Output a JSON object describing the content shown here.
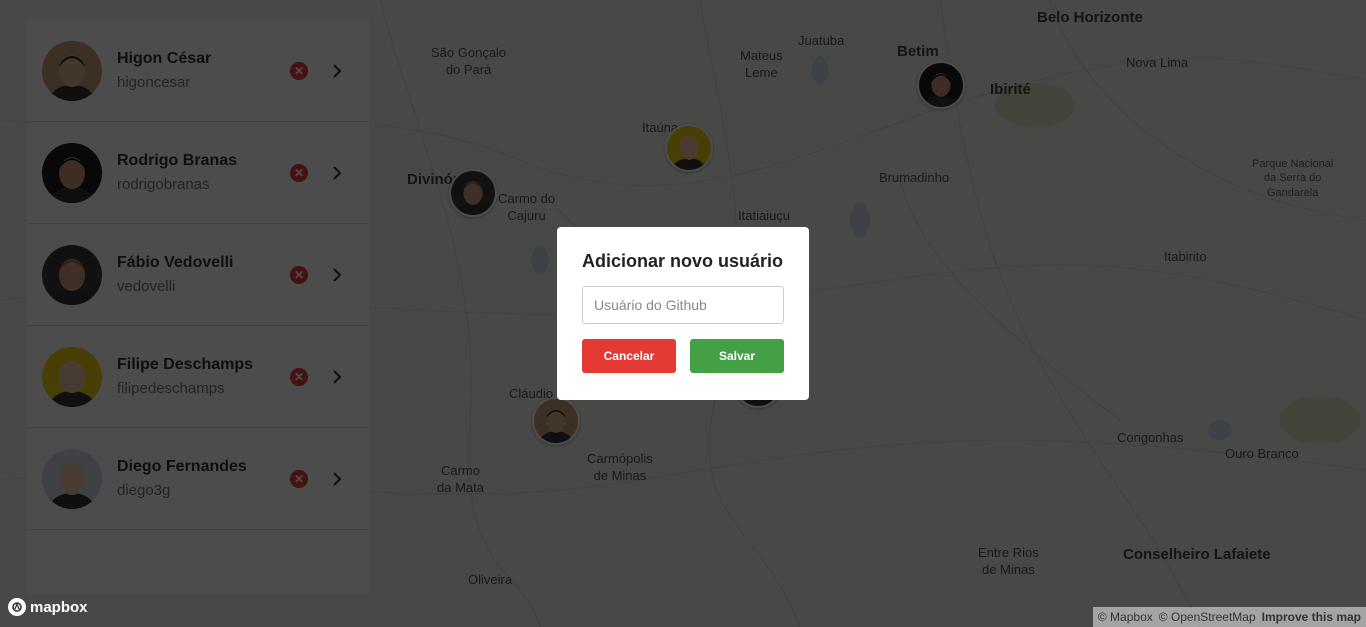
{
  "map": {
    "places": [
      {
        "name": "Belo Horizonte",
        "cls": "city"
      },
      {
        "name": "Nova Lima",
        "cls": ""
      },
      {
        "name": "Betim",
        "cls": "city"
      },
      {
        "name": "Ibirité",
        "cls": "city"
      },
      {
        "name": "Juatuba",
        "cls": ""
      },
      {
        "name": "Mateus\nLeme",
        "cls": ""
      },
      {
        "name": "São Gonçalo\ndo Pará",
        "cls": ""
      },
      {
        "name": "Itaúna",
        "cls": ""
      },
      {
        "name": "Brumadinho",
        "cls": ""
      },
      {
        "name": "Divinópolis",
        "cls": "city"
      },
      {
        "name": "Carmo do\nCajuru",
        "cls": ""
      },
      {
        "name": "Itatiaiuçu",
        "cls": ""
      },
      {
        "name": "Itabirito",
        "cls": ""
      },
      {
        "name": "Parque Nacional\nda Serra do\nGandarela",
        "cls": "small"
      },
      {
        "name": "Cláudio",
        "cls": ""
      },
      {
        "name": "Carmo\nda Mata",
        "cls": ""
      },
      {
        "name": "Carmópolis\nde Minas",
        "cls": ""
      },
      {
        "name": "Congonhas",
        "cls": ""
      },
      {
        "name": "Ouro Branco",
        "cls": ""
      },
      {
        "name": "Entre Rios\nde Minas",
        "cls": ""
      },
      {
        "name": "Conselheiro Lafaiete",
        "cls": "city"
      },
      {
        "name": "Oliveira",
        "cls": ""
      }
    ],
    "markers": [
      "higoncesar",
      "rodrigobranas",
      "vedovelli",
      "filipedeschamps",
      "diego3g",
      "extra"
    ]
  },
  "users": [
    {
      "name": "Higon César",
      "login": "higoncesar",
      "avatar_bg": "#c9a27e",
      "skin": "#e0b48e",
      "hair": "#2b1b12"
    },
    {
      "name": "Rodrigo Branas",
      "login": "rodrigobranas",
      "avatar_bg": "#1c1c1c",
      "skin": "#c89a78",
      "hair": "#1a1410"
    },
    {
      "name": "Fábio Vedovelli",
      "login": "vedovelli",
      "avatar_bg": "#3a3a3a",
      "skin": "#d2a084",
      "hair": "#8a6a55"
    },
    {
      "name": "Filipe Deschamps",
      "login": "filipedeschamps",
      "avatar_bg": "#f2d21a",
      "skin": "#f0c9a8",
      "hair": "#e8d7a0"
    },
    {
      "name": "Diego Fernandes",
      "login": "diego3g",
      "avatar_bg": "#d7dbe3",
      "skin": "#f1cdb3",
      "hair": "#e9d49a"
    }
  ],
  "modal": {
    "title": "Adicionar novo usuário",
    "input_placeholder": "Usuário do Github",
    "input_value": "",
    "cancel_label": "Cancelar",
    "save_label": "Salvar"
  },
  "chrome": {
    "logo_text": "mapbox",
    "attribution_mapbox": "© Mapbox",
    "attribution_osm": "© OpenStreetMap",
    "improve_label": "Improve this map"
  },
  "colors": {
    "cancel": "#e53935",
    "save": "#43a047",
    "remove": "#e63c3c"
  }
}
